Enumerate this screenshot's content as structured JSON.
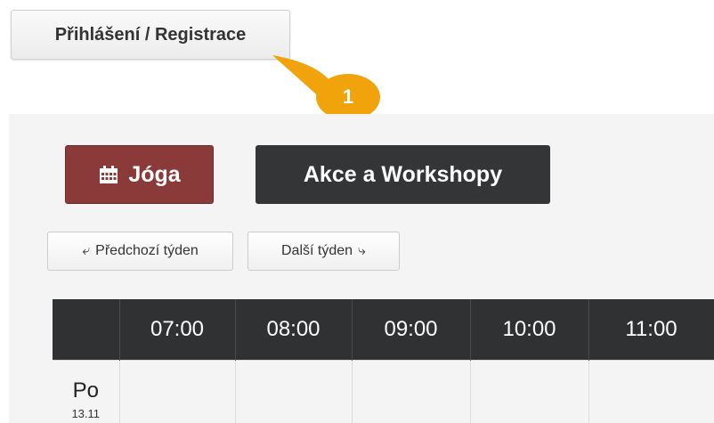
{
  "header": {
    "login_label": "Přihlášení / Registrace"
  },
  "callout": {
    "number": "1",
    "color": "#f0a30a"
  },
  "tabs": {
    "joga_label": "Jóga",
    "akce_label": "Akce a Workshopy",
    "calendar_icon": "calendar-icon"
  },
  "week_nav": {
    "prev_label": "Předchozí týden",
    "next_label": "Další týden",
    "prev_icon": "arrow-left-icon",
    "next_icon": "arrow-right-icon"
  },
  "schedule": {
    "times": [
      "07:00",
      "08:00",
      "09:00",
      "10:00",
      "11:00"
    ],
    "rows": [
      {
        "day": "Po",
        "date": "13.11"
      }
    ]
  },
  "colors": {
    "joga_bg": "#8b3a3a",
    "akce_bg": "#333536",
    "table_header_bg": "#2f3133"
  }
}
